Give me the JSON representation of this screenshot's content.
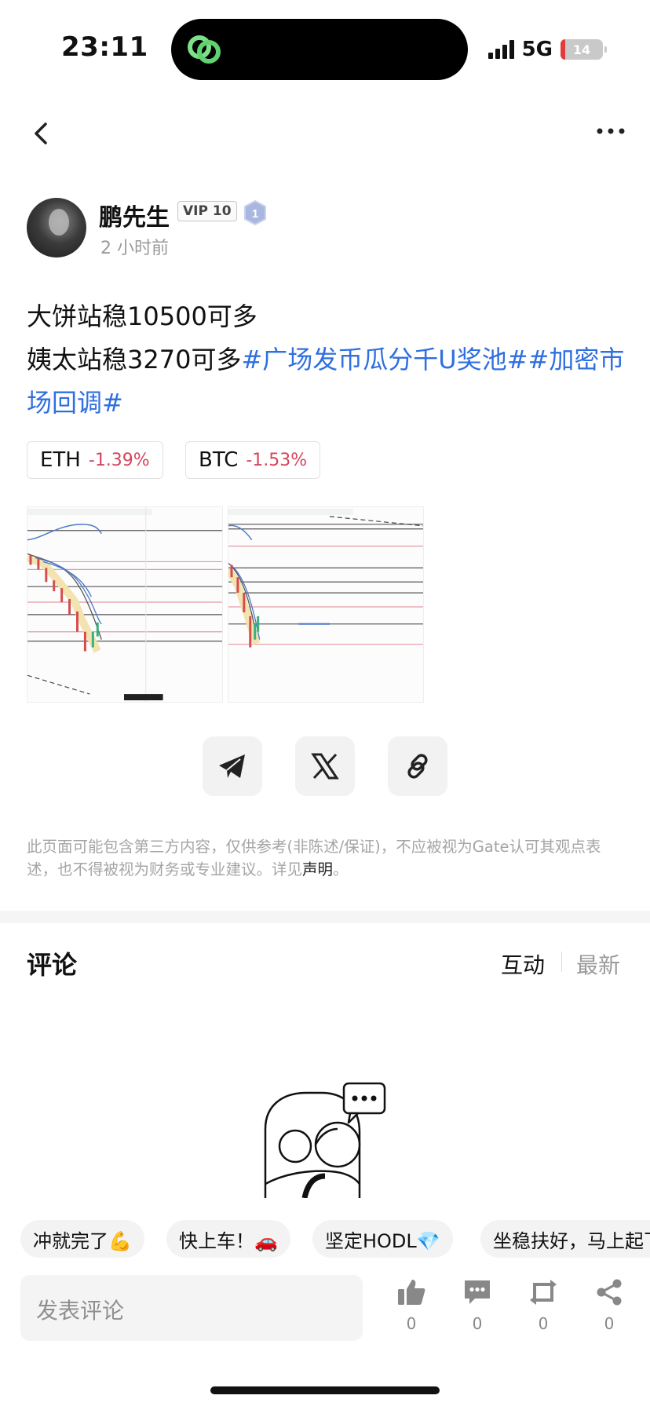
{
  "status_bar": {
    "time": "23:11",
    "network": "5G",
    "battery": "14"
  },
  "post": {
    "author": "鹏先生",
    "vip": "VIP 10",
    "level": "1",
    "time": "2 小时前",
    "line1": "大饼站稳10500可多",
    "line2_text": "姨太站稳3270可多",
    "tag1": "#广场发币瓜分千U奖池#",
    "tag2": "#加密市场回调#"
  },
  "tickers": [
    {
      "symbol": "ETH",
      "change": "-1.39%"
    },
    {
      "symbol": "BTC",
      "change": "-1.53%"
    }
  ],
  "share": {
    "telegram": "telegram-icon",
    "x": "x-icon",
    "link": "link-icon"
  },
  "disclaimer": {
    "text": "此页面可能包含第三方内容，仅供参考(非陈述/保证)，不应被视为Gate认可其观点表述，也不得被视为财务或专业建议。详见",
    "link": "声明",
    "end": "。"
  },
  "comments": {
    "title": "评论",
    "tab_active": "互动",
    "tab_latest": "最新",
    "quick_replies": [
      "冲就完了💪",
      "快上车！🚗",
      "坚定HODL💎",
      "坐稳扶好，马上起飞"
    ],
    "input_placeholder": "发表评论"
  },
  "actions": [
    {
      "icon": "like-icon",
      "count": "0"
    },
    {
      "icon": "comment-icon",
      "count": "0"
    },
    {
      "icon": "repost-icon",
      "count": "0"
    },
    {
      "icon": "share-icon",
      "count": "0"
    }
  ],
  "colors": {
    "tag": "#2f6fe0",
    "negative": "#d6455b"
  }
}
